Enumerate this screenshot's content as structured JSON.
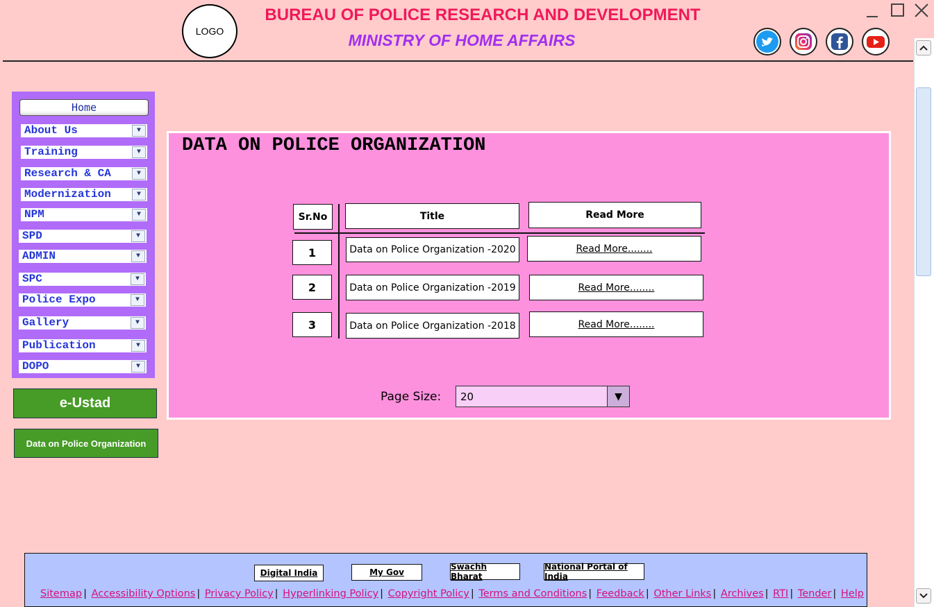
{
  "header": {
    "logo_text": "LOGO",
    "title": "BUREAU OF POLICE RESEARCH AND DEVELOPMENT",
    "subtitle": "MINISTRY OF HOME AFFAIRS",
    "social": [
      "twitter-icon",
      "instagram-icon",
      "facebook-icon",
      "youtube-icon"
    ]
  },
  "window_controls": [
    "minimize-icon",
    "maximize-icon",
    "close-icon"
  ],
  "sidebar": {
    "home_label": "Home",
    "items": [
      {
        "label": "About Us"
      },
      {
        "label": "Training"
      },
      {
        "label": "Research & CA"
      },
      {
        "label": "Modernization"
      },
      {
        "label": "NPM"
      },
      {
        "label": "SPD"
      },
      {
        "label": "ADMIN"
      },
      {
        "label": "SPC"
      },
      {
        "label": "Police Expo"
      },
      {
        "label": "Gallery"
      },
      {
        "label": "Publication"
      },
      {
        "label": "DOPO"
      }
    ],
    "eustad_label": "e-Ustad",
    "dopo_label": "Data on Police Organization"
  },
  "main": {
    "title": "DATA ON POLICE ORGANIZATION",
    "table": {
      "headers": [
        "Sr.No",
        "Title",
        "Read More"
      ],
      "rows": [
        {
          "sr": "1",
          "title": "Data on Police Organization -2020",
          "link": "Read More........"
        },
        {
          "sr": "2",
          "title": "Data on Police Organization -2019",
          "link": "Read More........"
        },
        {
          "sr": "3",
          "title": "Data on Police Organization -2018",
          "link": "Read More........"
        }
      ]
    },
    "page_size_label": "Page Size:",
    "page_size_value": "20"
  },
  "footer": {
    "buttons": [
      "Digital India",
      "My Gov",
      "Swachh Bharat",
      "National Portal of India"
    ],
    "links": [
      "Sitemap",
      "Accessibility Options",
      "Privacy Policy",
      "Hyperlinking Policy",
      "Copyright Policy",
      "Terms and Conditions",
      "Feedback",
      "Other Links",
      "Archives",
      "RTI",
      "Tender",
      "Help"
    ]
  },
  "colors": {
    "background": "#ffcccb",
    "title": "#f0195a",
    "subtitle": "#a22ef0",
    "sidebar": "#b06cf8",
    "panel": "#fe91de",
    "green_button": "#479b27",
    "footer": "#b3c4ff",
    "footer_link": "#d4117b"
  }
}
